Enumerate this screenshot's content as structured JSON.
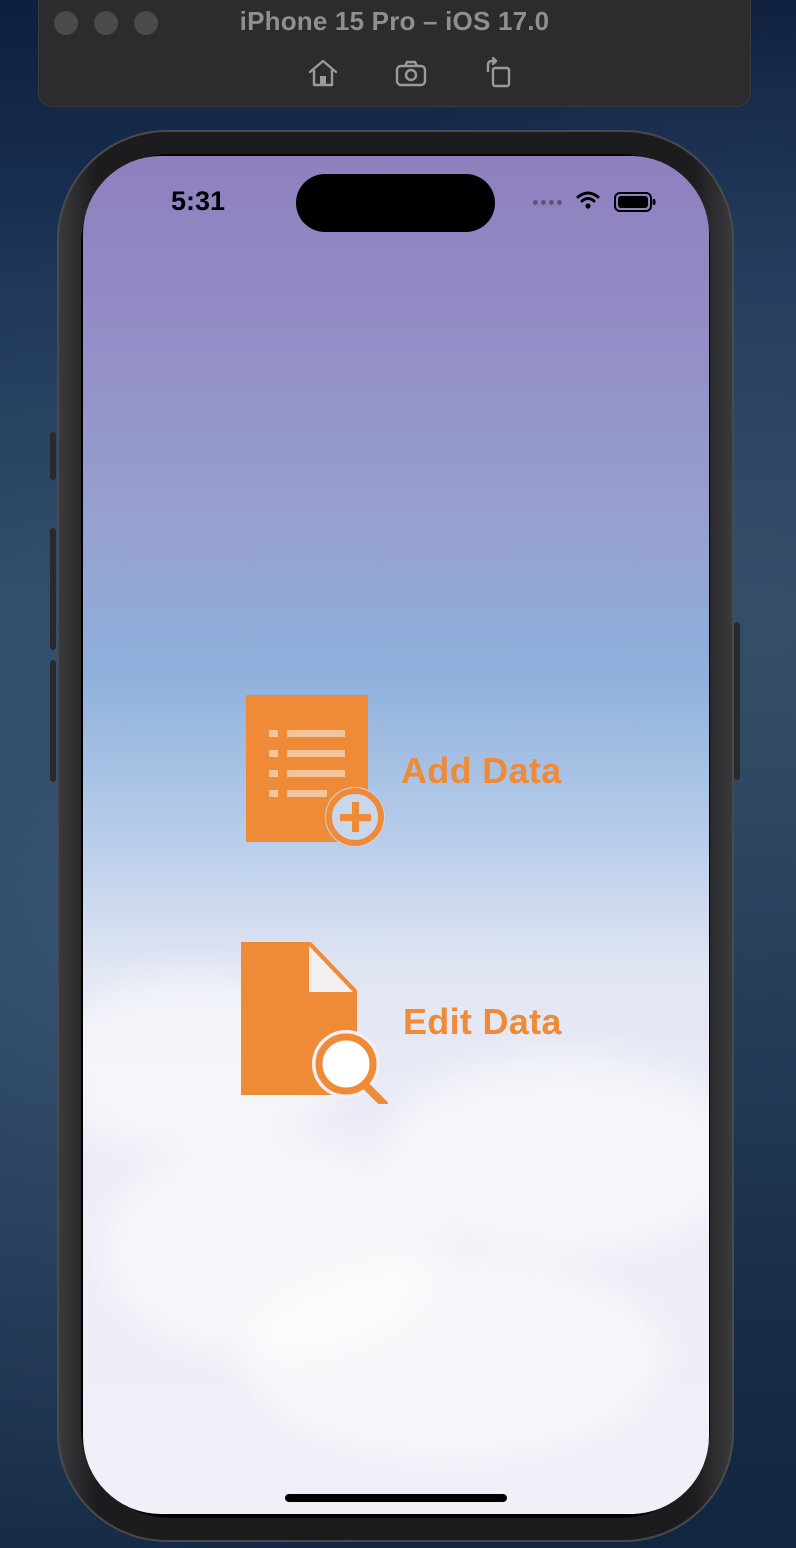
{
  "simulator": {
    "title": "iPhone 15 Pro – iOS 17.0",
    "tools": [
      {
        "icon": "home-icon"
      },
      {
        "icon": "screenshot-icon"
      },
      {
        "icon": "rotate-icon"
      }
    ]
  },
  "status_bar": {
    "time": "5:31",
    "icons": [
      "signal-icon",
      "wifi-icon",
      "battery-icon"
    ]
  },
  "actions": [
    {
      "label": "Add Data",
      "icon": "add-document-icon"
    },
    {
      "label": "Edit Data",
      "icon": "search-document-icon"
    }
  ],
  "colors": {
    "accent": "#ef8a37",
    "gradient_top": "#8f7fbe",
    "gradient_bottom": "#f0f0f8"
  }
}
